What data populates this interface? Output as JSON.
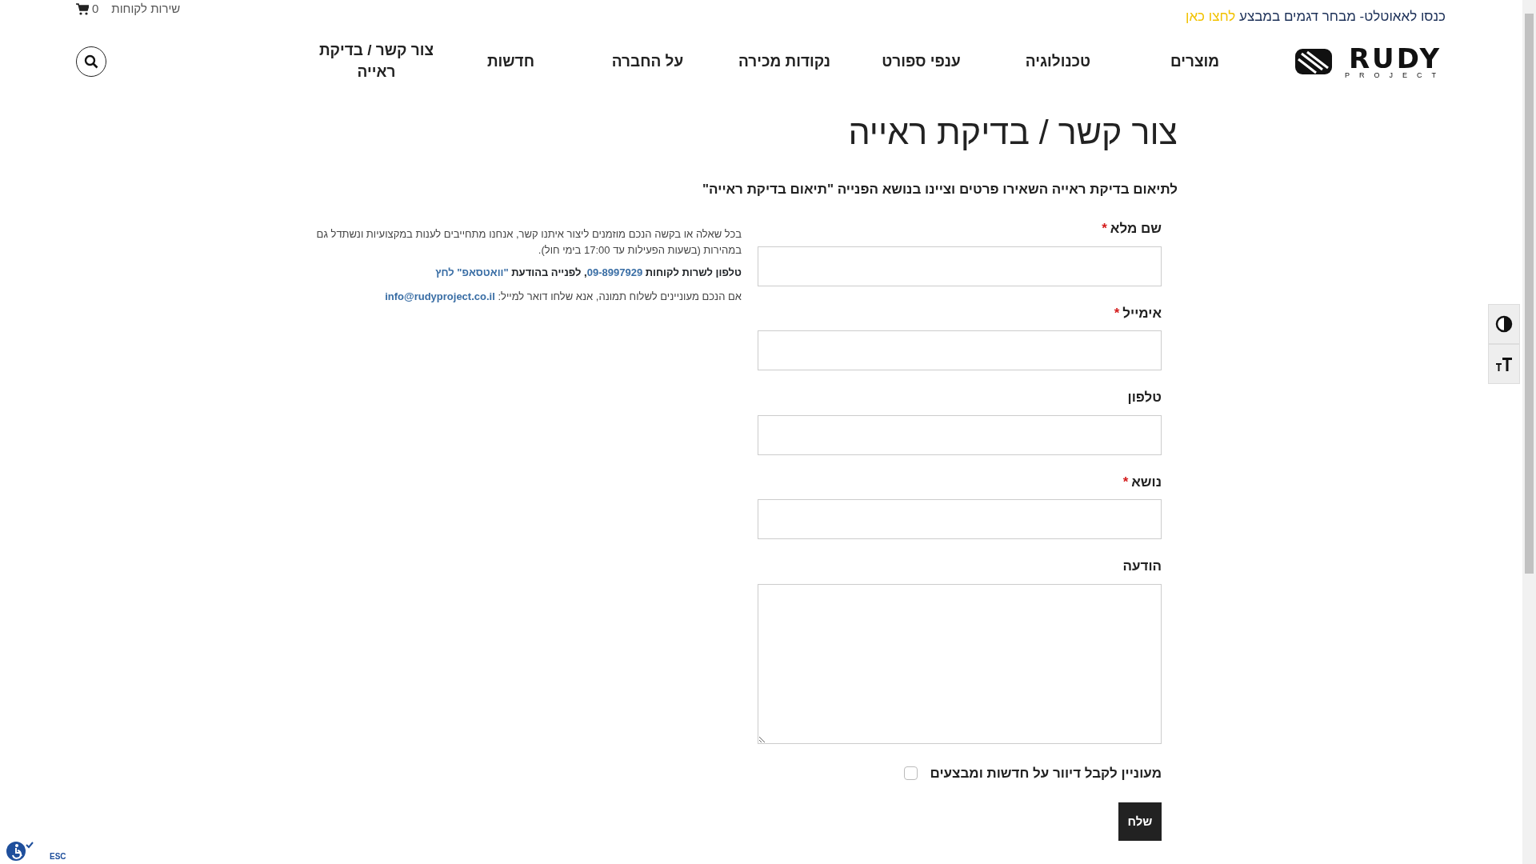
{
  "promo": {
    "text": "כנסו לאאוטלט- מבחר דגמים במבצע",
    "link": "לחצו כאן"
  },
  "utility": {
    "customer_service": "שירות לקוחות",
    "cart_count": "0"
  },
  "logo": {
    "word": "RUDY",
    "sub": "PROJECT"
  },
  "nav": [
    {
      "label": "מוצרים"
    },
    {
      "label": "טכנולוגיה"
    },
    {
      "label": "ענפי ספורט"
    },
    {
      "label": "נקודות מכירה"
    },
    {
      "label": "על החברה"
    },
    {
      "label": "חדשות"
    },
    {
      "label": "צור קשר / בדיקת ראייה"
    }
  ],
  "heading": "צור קשר / בדיקת ראייה",
  "subheading": "לתיאום בדיקת ראייה השאירו פרטים וציינו בנושא הפנייה \"תיאום בדיקת ראייה\"",
  "form": {
    "fields": [
      {
        "label": "שם מלא",
        "required": true,
        "kind": "input"
      },
      {
        "label": "אימייל",
        "required": true,
        "kind": "input"
      },
      {
        "label": "טלפון",
        "required": false,
        "kind": "input"
      },
      {
        "label": "נושא",
        "required": true,
        "kind": "input"
      },
      {
        "label": "הודעה",
        "required": false,
        "kind": "textarea"
      }
    ],
    "newsletter": {
      "label": "מעוניין לקבל דיוור על חדשות ומבצעים",
      "checked": false
    },
    "submit": "שלח",
    "required_mark": "*"
  },
  "info": {
    "paragraph": "בכל שאלה או בקשה הנכם מוזמנים ליצור איתנו קשר, אנחנו מתחייבים לענות במקצועיות ונשתדל גם במהירות (בשעות הפעילות עד 17:00 בימי חול).",
    "phone_label": "טלפון לשרות לקוחות",
    "phone": "09-8997929",
    "whatsapp_label": ", לפנייה בהודעת",
    "whatsapp_link": "\"וואטסאפ\" לחץ",
    "email_label": "אם הנכם מעוניינים לשלוח תמונה, אנא שלחו דואר למייל:",
    "email": "info@rudyproject.co.il"
  },
  "accessibility": {
    "esc": "ESC"
  }
}
